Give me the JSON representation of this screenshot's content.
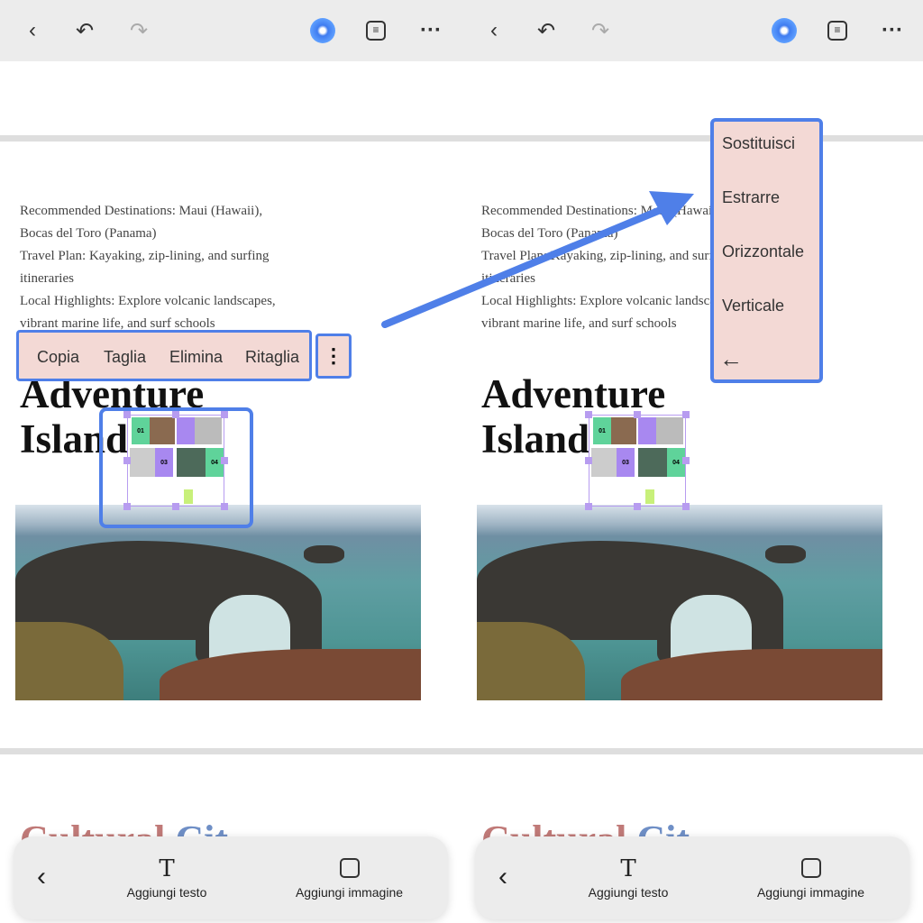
{
  "toolbar": {
    "back": "back-icon",
    "undo": "undo-icon",
    "redo": "redo-icon",
    "ai": "ai-assistant-icon",
    "outline": "list-icon",
    "more": "more-icon"
  },
  "document": {
    "lines": [
      "Recommended Destinations: Maui (Hawaii),",
      "Bocas del Toro (Panama)",
      "Travel Plan: Kayaking, zip-lining, and surfing",
      "itineraries",
      "Local Highlights: Explore volcanic landscapes,",
      "vibrant marine life, and surf schools"
    ],
    "heading_line1": "Adventure",
    "heading_line2": "Island",
    "next_heading_a": "Cultural ",
    "next_heading_b": "Cit",
    "collage_labels": [
      "01",
      "03",
      "04"
    ]
  },
  "context_menu": {
    "items": [
      "Copia",
      "Taglia",
      "Elimina",
      "Ritaglia"
    ],
    "more": "more-vertical-icon"
  },
  "submenu": {
    "items": [
      "Sostituisci",
      "Estrarre",
      "Orizzontale",
      "Verticale"
    ],
    "back": "arrow-left-icon"
  },
  "bottom_bar": {
    "add_text": "Aggiungi testo",
    "add_image": "Aggiungi immagine"
  },
  "colors": {
    "highlight": "#4f7fe8",
    "menu_bg": "#f3d9d5",
    "selection": "#b79cf0"
  }
}
